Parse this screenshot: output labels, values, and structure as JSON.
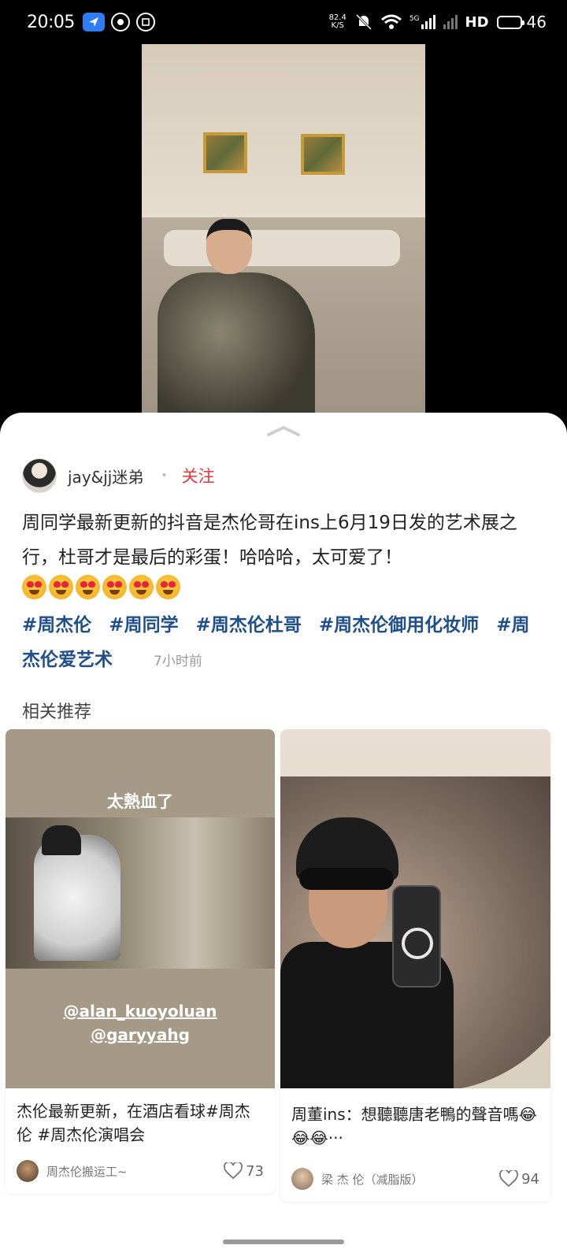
{
  "status_bar": {
    "time": "20:05",
    "net_speed": "82.4",
    "net_unit": "K/S",
    "signal_label": "5G",
    "hd_label": "HD",
    "battery": "46",
    "battery_level": 0.46
  },
  "post": {
    "author": "jay&jj迷弟",
    "follow_label": "关注",
    "text": "周同学最新更新的抖音是杰伦哥在ins上6月19日发的艺术展之行，杜哥才是最后的彩蛋！哈哈哈，太可爱了！",
    "emoji_count": 6,
    "tags": [
      "#周杰伦",
      "#周同学",
      "#周杰伦杜哥",
      "#周杰伦御用化妆师",
      "#周杰伦爱艺术"
    ],
    "time_ago": "7小时前"
  },
  "related": {
    "title": "相关推荐",
    "cards": [
      {
        "overlay_title": "太熱血了",
        "mention_1": "@alan_kuoyoluan",
        "mention_2": "@garyyahg",
        "caption": "杰伦最新更新，在酒店看球#周杰伦 #周杰伦演唱会",
        "author": "周杰伦搬运工~",
        "likes": "73"
      },
      {
        "caption": "周董ins：想聽聽唐老鴨的聲音嗎😂😂😂···",
        "author": "梁 杰 伦（减脂版）",
        "likes": "94"
      }
    ]
  },
  "colors": {
    "follow": "#e4393c",
    "tag": "#1f4e8c",
    "nav_icon_bg": "#2f7df6"
  }
}
